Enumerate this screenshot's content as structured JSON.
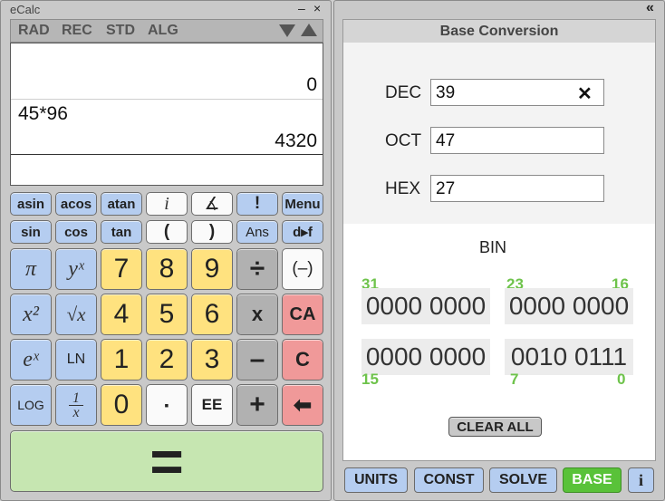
{
  "app": {
    "title": "eCalc",
    "minimize": "–",
    "close": "×",
    "collapse": "«"
  },
  "modes": [
    "RAD",
    "REC",
    "STD",
    "ALG"
  ],
  "display": {
    "line1_result": "0",
    "line2_expr": "45*96",
    "line2_result": "4320"
  },
  "keys": {
    "asin": "asin",
    "acos": "acos",
    "atan": "atan",
    "i": "i",
    "angle": "∡",
    "fact": "!",
    "menu": "Menu",
    "sin": "sin",
    "cos": "cos",
    "tan": "tan",
    "lparen": "(",
    "rparen": ")",
    "ans": "Ans",
    "dtof": "d▸f",
    "pi": "π",
    "yx": "yˣ",
    "sqrt": "√x",
    "x2": "x²",
    "ex": "eˣ",
    "ln": "LN",
    "log": "LOG",
    "recip_num": "1",
    "recip_den": "x",
    "n7": "7",
    "n8": "8",
    "n9": "9",
    "n4": "4",
    "n5": "5",
    "n6": "6",
    "n1": "1",
    "n2": "2",
    "n3": "3",
    "n0": "0",
    "dot": "▪",
    "ee": "EE",
    "div": "÷",
    "mul": "x",
    "sub": "–",
    "add": "+",
    "neg": "(–)",
    "ca": "CA",
    "c": "C",
    "back": "⬅",
    "equals": "="
  },
  "base": {
    "header": "Base Conversion",
    "dec_label": "DEC",
    "dec_value": "39",
    "clear_icon": "✕",
    "oct_label": "OCT",
    "oct_value": "47",
    "hex_label": "HEX",
    "hex_value": "27",
    "bin_label": "BIN",
    "bits": {
      "b31": "31",
      "b23": "23",
      "b16": "16",
      "b15": "15",
      "b7": "7",
      "b0": "0"
    },
    "groups": [
      "0000 0000",
      "0000 0000",
      "0000 0000",
      "0010 0111"
    ],
    "clear_all": "CLEAR ALL"
  },
  "tabs": {
    "units": "UNITS",
    "const": "CONST",
    "solve": "SOLVE",
    "base": "BASE",
    "info": "i"
  },
  "colors": {
    "accent_green": "#6ec34b",
    "active_tab": "#59c239",
    "key_blue": "#b5cdf0",
    "key_yellow": "#ffe27f",
    "key_red": "#f09999"
  }
}
